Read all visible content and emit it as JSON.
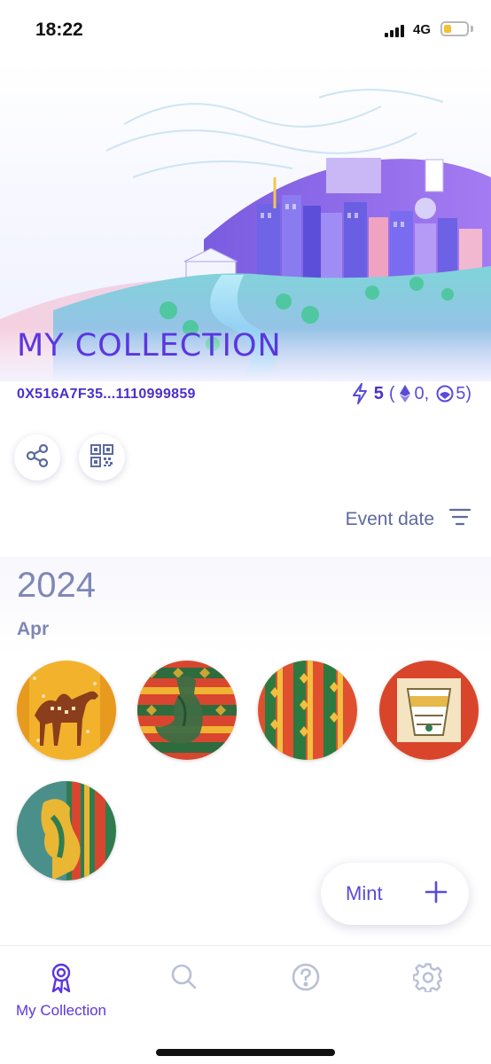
{
  "status_bar": {
    "time": "18:22",
    "network": "4G",
    "battery_level": 0.2,
    "battery_color": "#f2c233"
  },
  "page": {
    "title": "MY COLLECTION",
    "address": "0X516A7F35...1110999859",
    "stats": {
      "total": "5",
      "open_paren": "(",
      "eth_count": "0,",
      "gnosis_count": "5)",
      "icons": [
        "lightning-icon",
        "ethereum-icon",
        "gnosis-icon"
      ]
    },
    "actions": [
      "share-icon",
      "qr-code-icon"
    ],
    "sort_label": "Event date",
    "year": "2024",
    "month": "Apr"
  },
  "tokens": [
    {
      "name": "camel-token",
      "colors": [
        "#f2b22b",
        "#8a3e1b"
      ]
    },
    {
      "name": "dallah-pattern-token",
      "colors": [
        "#2e6b3d",
        "#d8462f"
      ]
    },
    {
      "name": "stripe-pattern-token",
      "colors": [
        "#e0502f",
        "#2c7a3f"
      ]
    },
    {
      "name": "coffee-cup-token",
      "colors": [
        "#d9452b",
        "#f0d27a"
      ]
    },
    {
      "name": "green-dallah-token",
      "colors": [
        "#2f7c4f",
        "#e9b733"
      ]
    }
  ],
  "mint": {
    "label": "Mint"
  },
  "tabs": [
    {
      "label": "My Collection",
      "icon": "ribbon-badge-icon",
      "active": true
    },
    {
      "label": "",
      "icon": "search-icon",
      "active": false
    },
    {
      "label": "",
      "icon": "help-icon",
      "active": false
    },
    {
      "label": "",
      "icon": "gear-icon",
      "active": false
    }
  ],
  "colors": {
    "accent": "#5b36e0",
    "muted": "#7f87b7",
    "inactive_icon": "#b9bfd6"
  }
}
